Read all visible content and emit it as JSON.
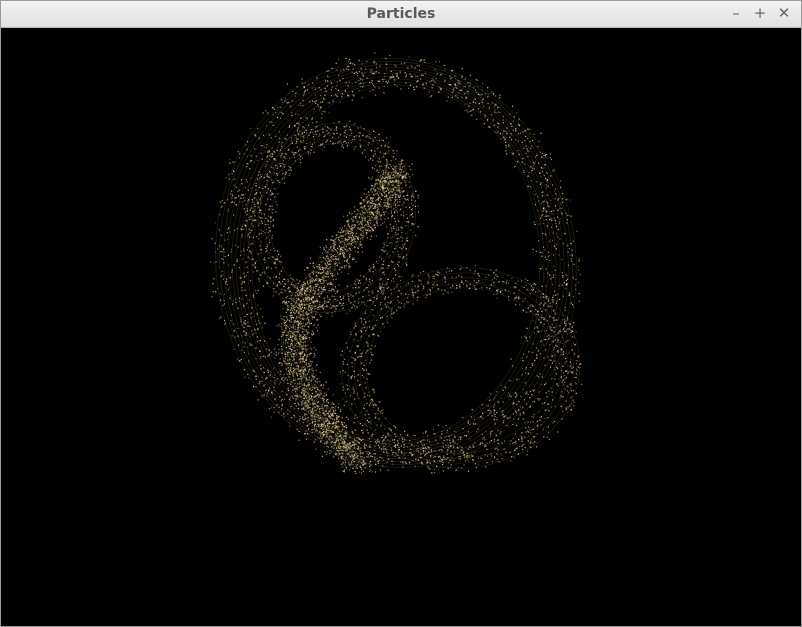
{
  "window": {
    "title": "Particles",
    "controls": {
      "minimize_glyph": "–",
      "maximize_glyph": "+",
      "close_glyph": "✕"
    }
  },
  "scene": {
    "description_icon": "particle-attractor",
    "background_color": "#000000",
    "particle_colors": [
      "#f2c9a0",
      "#e9b98e",
      "#d9c7a6",
      "#8c9a4a",
      "#6f7d3a",
      "#c9a27a"
    ]
  }
}
